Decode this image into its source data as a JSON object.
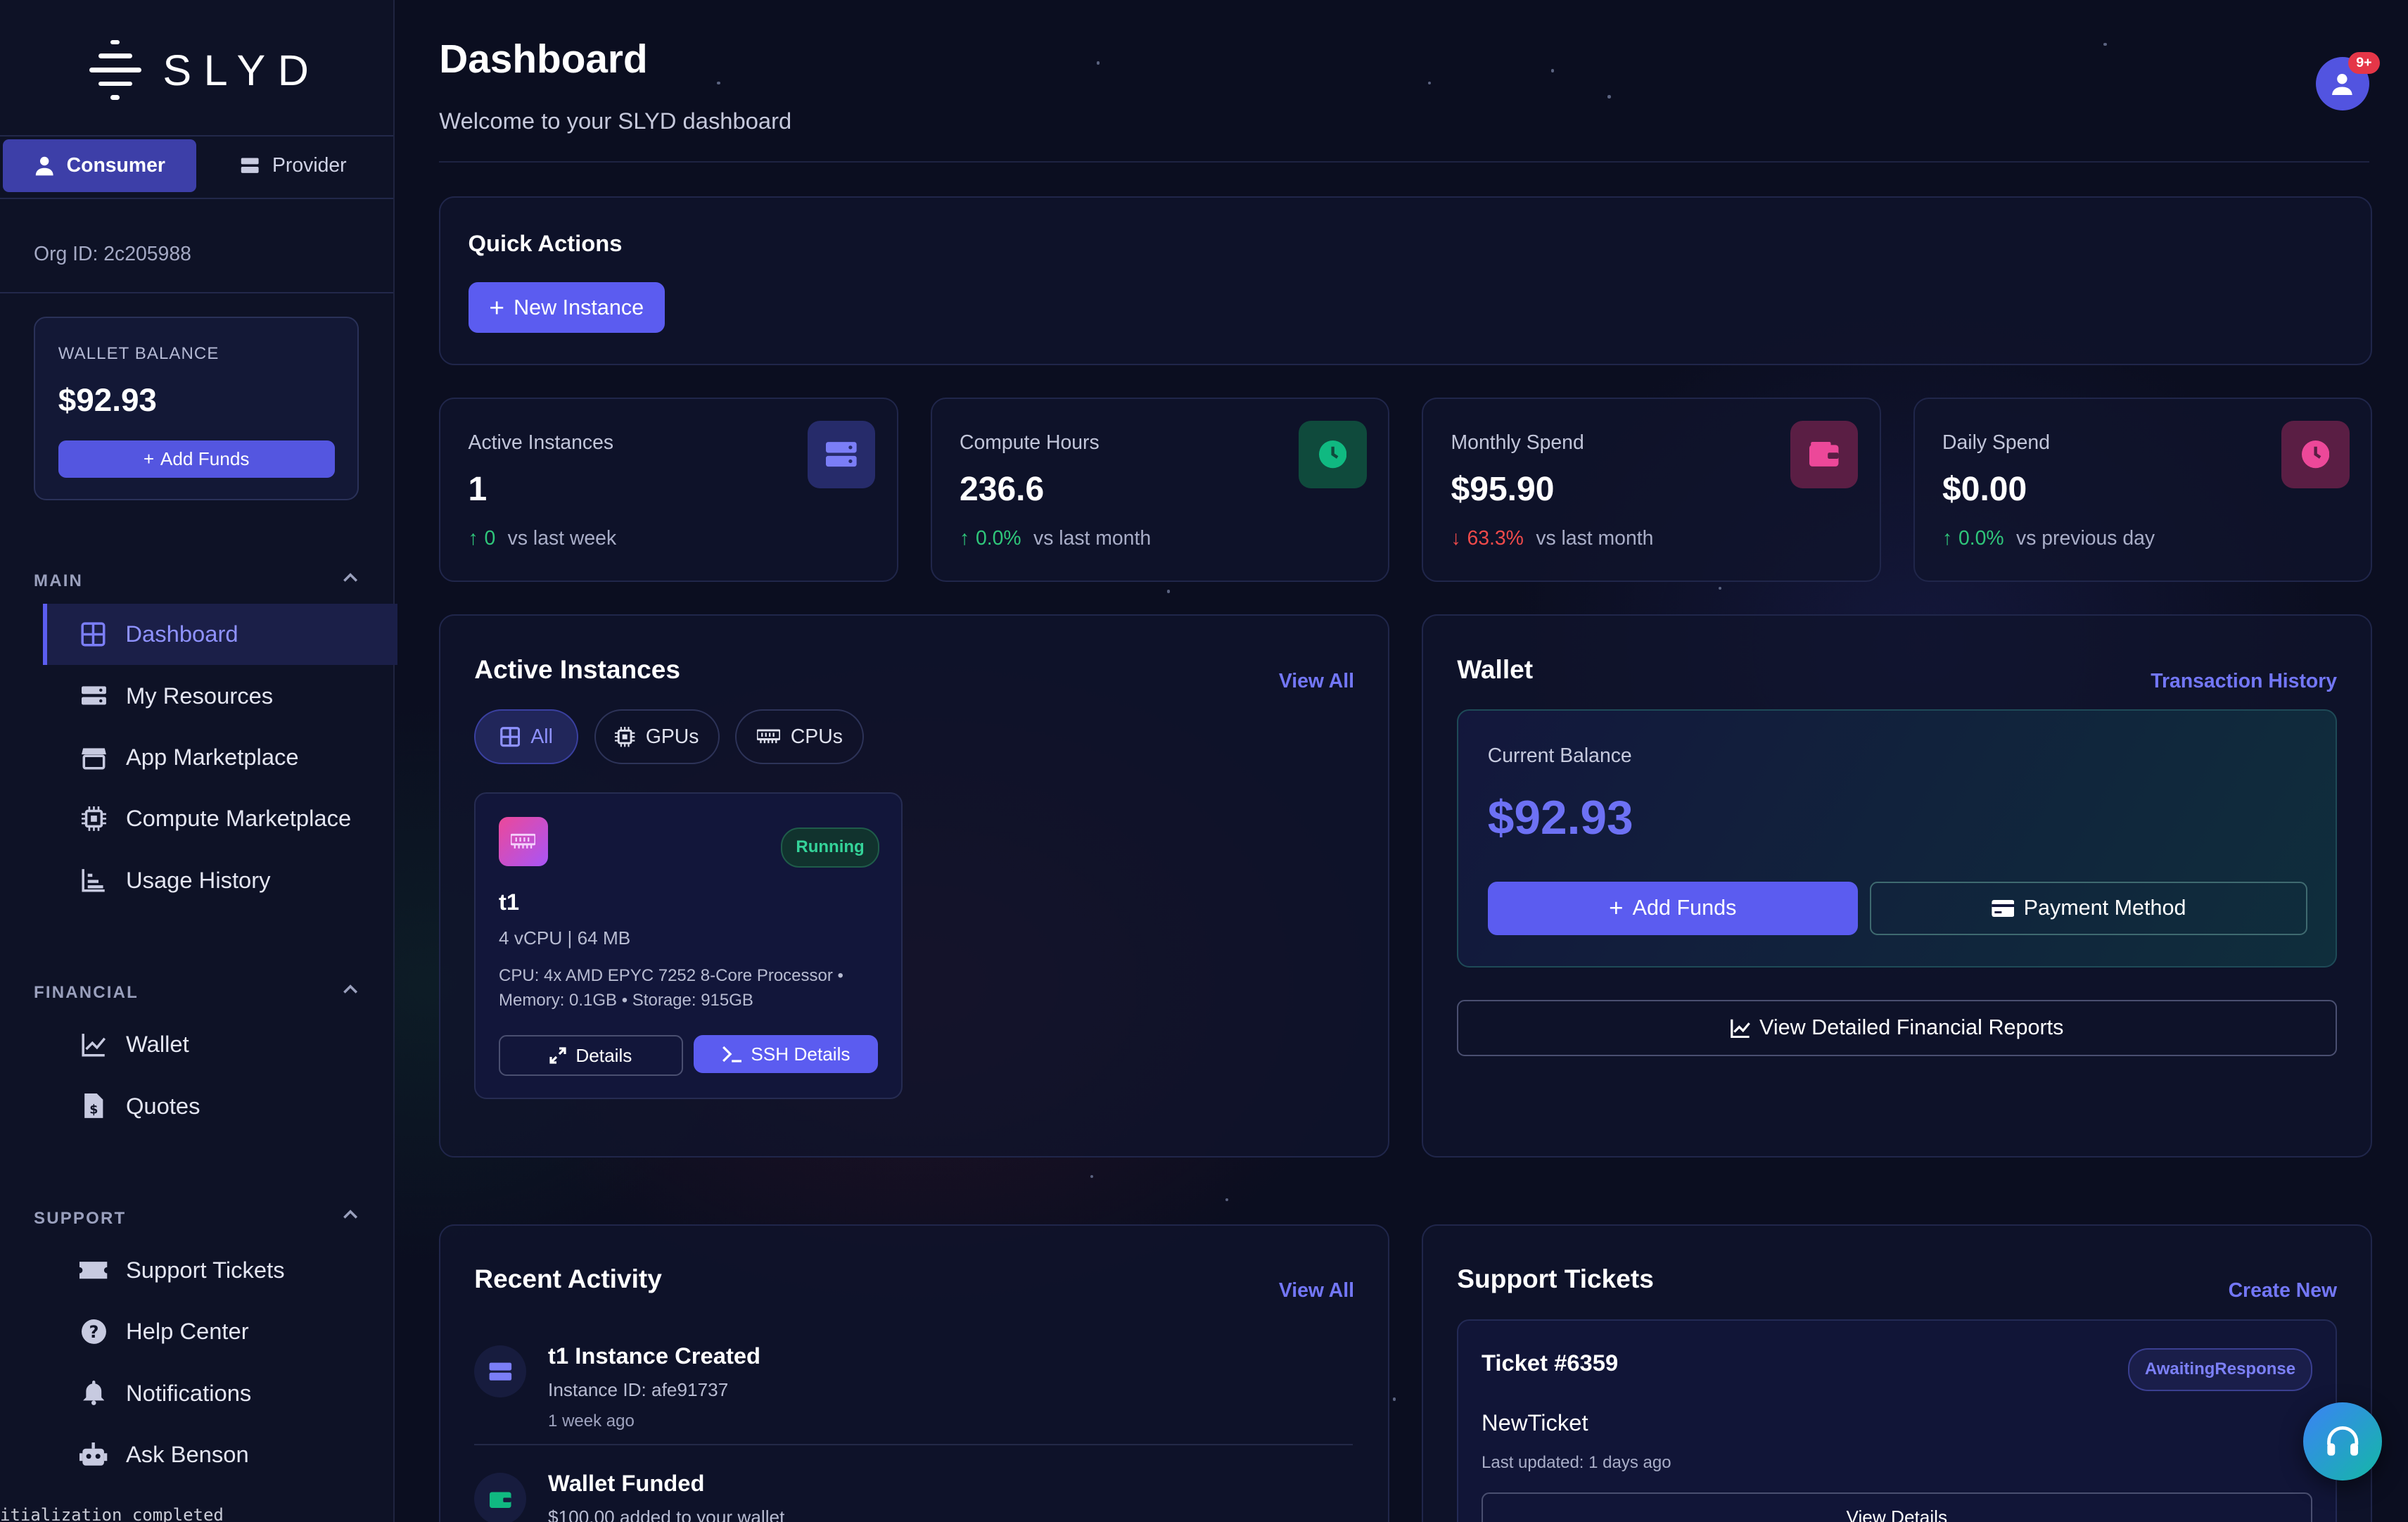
{
  "brand": {
    "name": "SLYD"
  },
  "mode_switch": {
    "consumer": "Consumer",
    "provider": "Provider"
  },
  "org": {
    "label": "Org ID: 2c205988"
  },
  "sidebar_wallet": {
    "label": "WALLET BALANCE",
    "amount": "$92.93",
    "add_funds": "Add Funds"
  },
  "sections": {
    "main": {
      "title": "MAIN",
      "items": [
        {
          "label": "Dashboard",
          "icon": "grid-icon",
          "active": true
        },
        {
          "label": "My Resources",
          "icon": "server-icon"
        },
        {
          "label": "App Marketplace",
          "icon": "store-icon"
        },
        {
          "label": "Compute Marketplace",
          "icon": "chip-icon"
        },
        {
          "label": "Usage History",
          "icon": "bar-chart-icon"
        }
      ]
    },
    "financial": {
      "title": "FINANCIAL",
      "items": [
        {
          "label": "Wallet",
          "icon": "line-chart-icon"
        },
        {
          "label": "Quotes",
          "icon": "invoice-icon"
        }
      ]
    },
    "support": {
      "title": "SUPPORT",
      "items": [
        {
          "label": "Support Tickets",
          "icon": "ticket-icon"
        },
        {
          "label": "Help Center",
          "icon": "question-icon"
        },
        {
          "label": "Notifications",
          "icon": "bell-icon"
        },
        {
          "label": "Ask Benson",
          "icon": "robot-icon"
        }
      ]
    }
  },
  "console_text": "itialization completed",
  "header": {
    "title": "Dashboard",
    "subtitle": "Welcome to your SLYD dashboard",
    "badge": "9+"
  },
  "quick_actions": {
    "title": "Quick Actions",
    "new_instance": "New Instance"
  },
  "stats": [
    {
      "label": "Active Instances",
      "value": "1",
      "delta": "0",
      "direction": "up",
      "compare": "vs last week",
      "color": "#6366f1"
    },
    {
      "label": "Compute Hours",
      "value": "236.6",
      "delta": "0.0%",
      "direction": "up",
      "compare": "vs last month",
      "color": "#10b981"
    },
    {
      "label": "Monthly Spend",
      "value": "$95.90",
      "delta": "63.3%",
      "direction": "down",
      "compare": "vs last month",
      "color": "#ec4899"
    },
    {
      "label": "Daily Spend",
      "value": "$0.00",
      "delta": "0.0%",
      "direction": "up",
      "compare": "vs previous day",
      "color": "#ec4899"
    }
  ],
  "active_instances": {
    "title": "Active Instances",
    "view_all": "View All",
    "filters": {
      "all": "All",
      "gpus": "GPUs",
      "cpus": "CPUs"
    },
    "instance": {
      "status": "Running",
      "name": "t1",
      "spec": "4 vCPU | 64 MB",
      "detail": "CPU: 4x AMD EPYC 7252 8-Core Processor • Memory: 0.1GB • Storage: 915GB",
      "details_btn": "Details",
      "ssh_btn": "SSH Details"
    }
  },
  "wallet": {
    "title": "Wallet",
    "history": "Transaction History",
    "balance_label": "Current Balance",
    "balance": "$92.93",
    "add_funds": "Add Funds",
    "payment_method": "Payment Method",
    "reports": "View Detailed Financial Reports"
  },
  "recent_activity": {
    "title": "Recent Activity",
    "view_all": "View All",
    "items": [
      {
        "title": "t1 Instance Created",
        "sub": "Instance ID: afe91737",
        "time": "1 week ago"
      },
      {
        "title": "Wallet Funded",
        "sub": "$100.00 added to your wallet"
      }
    ]
  },
  "support_tickets": {
    "title": "Support Tickets",
    "create": "Create New",
    "ticket": {
      "number": "Ticket #6359",
      "status": "AwaitingResponse",
      "subject": "NewTicket",
      "updated": "Last updated: 1 days ago",
      "view": "View Details"
    }
  }
}
